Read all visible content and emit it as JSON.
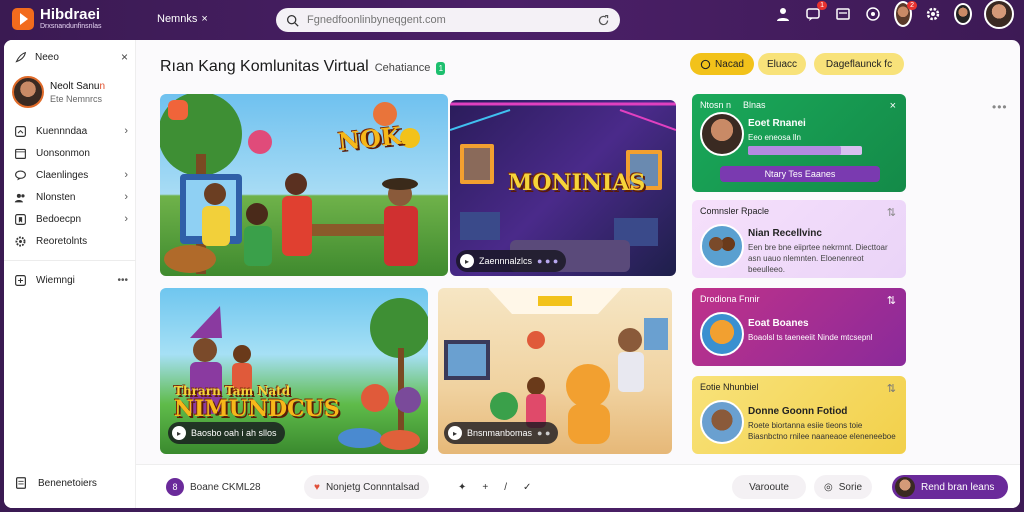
{
  "app": {
    "name": "Hibdraei",
    "tagline": "Drxsnandunfinsnlas",
    "top_tab": "Nemnks",
    "top_tab_close": "×",
    "search_placeholder": "Fgnedfoonlinbyneqgent.com",
    "notif_badge": "1",
    "profile_badge": "2"
  },
  "sidebar": {
    "header": "Neeo",
    "close": "×",
    "user_name": "Neolt Sanu",
    "user_name_accent": "n",
    "user_sub": "Ete Nemnrcs",
    "items": [
      {
        "label": "Kuennndaa",
        "icon": "home-icon",
        "chev": "›"
      },
      {
        "label": "Uonsonmon",
        "icon": "calendar-icon",
        "chev": ""
      },
      {
        "label": "Claenlinges",
        "icon": "chat-icon",
        "chev": "›"
      },
      {
        "label": "Nlonsten",
        "icon": "people-icon",
        "chev": "›"
      },
      {
        "label": "Bedoecpn",
        "icon": "bookmark-icon",
        "chev": "›"
      },
      {
        "label": "Reoretolnts",
        "icon": "settings-icon",
        "chev": ""
      }
    ],
    "group_label": "Wiemngi",
    "group_more": "•••",
    "footer_label": "Benenetoiers"
  },
  "header": {
    "title": "Rıan Kang Komlunitas Virtual",
    "subtitle": "Cehatiance",
    "subtitle_badge": "1",
    "pills": [
      "Nacad",
      "Eluacc",
      "Dageflaunck fc"
    ]
  },
  "cards": [
    {
      "caption": "",
      "banner": "NOK",
      "banner2": ""
    },
    {
      "caption": "Zaennnalzlcs",
      "banner": "MONINIAS",
      "banner2": ""
    },
    {
      "caption": "Baosbo oah i ah sllos",
      "banner": "Thrarn Tam Natd",
      "banner2": "NIMUNDCUS"
    },
    {
      "caption": "Bnsnmanbomas",
      "banner": "",
      "banner2": ""
    }
  ],
  "side_cards": [
    {
      "head1": "Ntosn n",
      "head2": "Blnas",
      "close": "×",
      "title": "Eoet Rnanei",
      "sub": "Eeo eneosa lln",
      "button": "Ntary Tes Eaanes",
      "progress": 0.82
    },
    {
      "head1": "Comnsler Rpacle",
      "head2": "",
      "close": "⇅",
      "title": "Nian Recellvinc",
      "sub": "Een bre bne eiiprtee nekrmnt. Diecttoar asn uauo nlemnten. Eloenenreot beeulleeo."
    },
    {
      "head1": "Drodiona Fnnir",
      "head2": "",
      "close": "⇅",
      "title": "Eoat Boanes",
      "sub": "Boaolsl ts taeneeiit Ninde mtcsepnl"
    },
    {
      "head1": "Eotie Nhunbiel",
      "head2": "",
      "close": "⇅",
      "title": "Donne Goonn Fotiod",
      "sub": "Roete biortanna esiie tieons toie Biasnbctno rnilee naaneaoe eleneneeboe"
    }
  ],
  "bottom": {
    "left_label": "Boane CKML28",
    "left_dot": "8",
    "center_label": "Nonjetg Connntalsad",
    "tools": [
      "✦",
      "+",
      "/",
      "✓"
    ],
    "btn1": "Varooute",
    "btn2": "Sorie",
    "cta": "Rend bran leans"
  },
  "colors": {
    "accent_purple": "#6a2a9a",
    "top_bar": "#3a1a52",
    "pill_gold": "#f2c21a",
    "card_green": "#1aa95a",
    "card_magenta": "#b5328a"
  }
}
